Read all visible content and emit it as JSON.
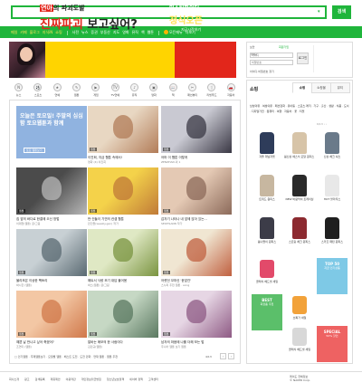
{
  "search": {
    "button_label": "검색",
    "placeholder": ""
  },
  "gnb": {
    "items": [
      "메일",
      "카페",
      "블로그",
      "지식iN",
      "쇼핑",
      "사전",
      "뉴스",
      "증권",
      "부동산",
      "지도",
      "영화",
      "뮤직",
      "책",
      "웹툰"
    ],
    "toggle_label": "모든메뉴",
    "more_label": "더보기"
  },
  "banner": {
    "line1_red": "연아",
    "line1_rest": "의 파괴도발",
    "line2_red": "진짜파괴",
    "line2_dark": " 보고싶어?",
    "right_top": "미스틱파이터",
    "right_mid": "정식오픈",
    "right_bottom": "지금시작하기"
  },
  "categories": [
    {
      "label": "뉴스",
      "icon": "news-icon"
    },
    {
      "label": "스포츠",
      "icon": "sports-icon"
    },
    {
      "label": "연예",
      "icon": "entertainment-icon"
    },
    {
      "label": "웹툰",
      "icon": "webtoon-icon"
    },
    {
      "label": "게임",
      "icon": "game-icon"
    },
    {
      "label": "TV연예",
      "icon": "tv-icon"
    },
    {
      "label": "뮤직",
      "icon": "music-icon"
    },
    {
      "label": "영화",
      "icon": "movie-icon"
    },
    {
      "label": "책",
      "icon": "book-icon"
    },
    {
      "label": "패션뷰티",
      "icon": "fashion-icon"
    },
    {
      "label": "리빙푸드",
      "icon": "food-icon"
    },
    {
      "label": "자동차",
      "icon": "car-icon"
    }
  ],
  "promo": {
    "text": "오늘은 토요일! 주말의 심심함 토요웹툰과 함께",
    "sub": "토요 웹툰보기"
  },
  "tiles": [
    {
      "cap": "이진희, 지금 웹툰 속에서!",
      "sub": "영화 (4) 이진희",
      "tag": "웹툰"
    },
    {
      "cap": "어머 이 웹툰 이렇게",
      "sub": "ZENZHAN 외 1",
      "tag": "웹툰"
    },
    {
      "cap": "집 앞의 바다로 한결에 오신 방법",
      "sub": "이대현(웹툰) 글/그림",
      "tag": "웹툰"
    },
    {
      "cap": "만·건들이 기연의 컨셉 웹툰",
      "sub": "만건들(weekly.gen) 작가",
      "tag": "웹툰"
    },
    {
      "cap": "갑자기 나타나 내 앞에 앉아 있는...",
      "sub": "SEOHSANN 작가",
      "tag": "웹툰"
    },
    {
      "cap": "물리조은 이상한 팩토리",
      "sub": "박시한 (웹툰)",
      "tag": "웹툰"
    },
    {
      "cap": "해트서 식량 조기 대답 물어봄",
      "sub": "박스(웹툰) 글/그림",
      "tag": "웹툰"
    },
    {
      "cap": "어렸던 꼬마신 '윤앞관'",
      "sub": "스누피 추천 웹툰 · song",
      "tag": "웹툰"
    },
    {
      "cap": "예쁜 날 만나고 싶어 죽겠어?",
      "sub": "조연미 (웹툰)",
      "tag": "웹툰"
    },
    {
      "cap": "알바는 메모의 한 사람이다",
      "sub": "김민규(웹툰)",
      "tag": "웹툰"
    },
    {
      "cap": "남자의 마음에 나를 더해 보는 법",
      "sub": "주니어 웹툰 보기 웹툰",
      "tag": "웹툰"
    }
  ],
  "left_pager": {
    "links": "□ 인기웹툰 · 주제웹툰보기 · 요일별 웹툰 · 베스트 도전 · 도전 만화 · 연재 웹툰 · 웹툰 추천",
    "page": "4/13"
  },
  "login": {
    "id_label": "아이디",
    "pw_label": "비밀번호",
    "id_placeholder": "아이디",
    "pw_placeholder": "비밀번호",
    "button": "로그인",
    "join": "회원가입",
    "find": "아이디·비밀번호 찾기",
    "secure": "보안"
  },
  "shop": {
    "title": "쇼핑",
    "tabs": [
      "쇼핑",
      "쇼핑몰",
      "뷰티"
    ],
    "links": "남성의류 · 여성의류 · 패션잡화 · 유아동 · 스포츠·레저 · 가구 · 출산 · 생활 · 식품 · 도서 · 디지털가전 · 컴퓨터 · 여행 · 자동차 · 꽃 · 티켓",
    "page": "6/13",
    "products": [
      {
        "cap": "겨울 데님자켓"
      },
      {
        "cap": "봄신상 에스닉 모달 원피스 세트"
      },
      {
        "cap": "신상 체크 셔츠"
      },
      {
        "cap": "트위드 원피스"
      },
      {
        "cap": "NEW 바람막이 트레이닝"
      },
      {
        "cap": "HOT 블라우스"
      },
      {
        "cap": "봄나들이 원피스"
      },
      {
        "cap": "스트링 체크 원피스"
      },
      {
        "cap": "스카프 패턴 원피스"
      }
    ],
    "ads": [
      {
        "title": "TOP 50",
        "text": "지금 인기상품",
        "color": "#7ec9e6"
      },
      {
        "title": "BEST",
        "text": "화장품 추천",
        "color": "#5bbf6a"
      },
      {
        "title": "SPECIAL",
        "text": "50% 할인",
        "color": "#ee6262"
      }
    ],
    "promo_item": "클래식 헤드셋 세일",
    "promo_sale": "초특가 세일"
  },
  "footer": {
    "links": [
      "회사소개",
      "광고",
      "검색등록",
      "제휴제안",
      "이용약관",
      "개인정보취급방침",
      "청소년보호정책",
      "네이버 정책",
      "고객센터"
    ],
    "copy1": "레이도 전체정보",
    "copy2": "© NAVER Corp."
  }
}
